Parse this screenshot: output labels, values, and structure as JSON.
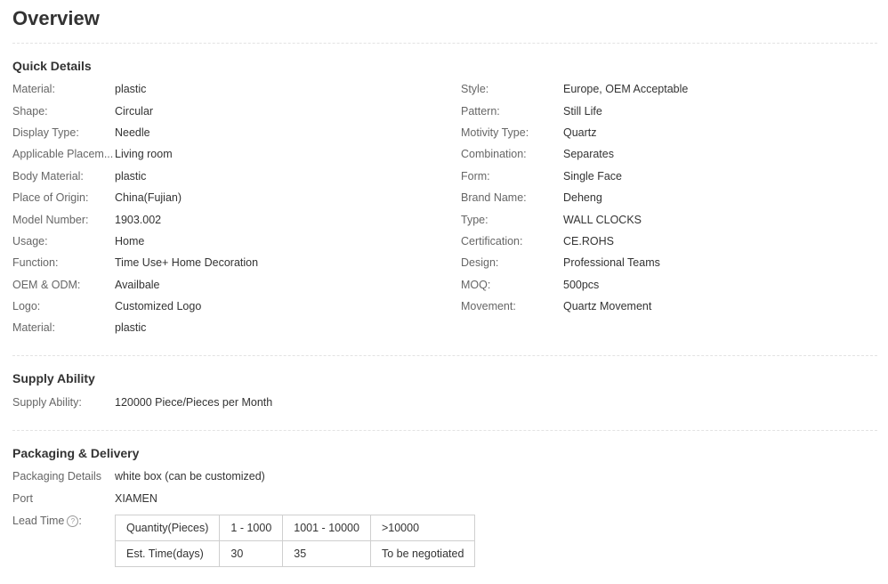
{
  "page_title": "Overview",
  "quick_details": {
    "heading": "Quick Details",
    "left": [
      {
        "label": "Material:",
        "value": "plastic"
      },
      {
        "label": "Shape:",
        "value": "Circular"
      },
      {
        "label": "Display Type:",
        "value": "Needle"
      },
      {
        "label": "Applicable Placem...",
        "value": "Living room"
      },
      {
        "label": "Body Material:",
        "value": "plastic"
      },
      {
        "label": "Place of Origin:",
        "value": "China(Fujian)"
      },
      {
        "label": "Model Number:",
        "value": "1903.002"
      },
      {
        "label": "Usage:",
        "value": "Home"
      },
      {
        "label": "Function:",
        "value": "Time Use+ Home Decoration"
      },
      {
        "label": "OEM & ODM:",
        "value": "Availbale"
      },
      {
        "label": "Logo:",
        "value": "Customized Logo"
      },
      {
        "label": "Material:",
        "value": "plastic"
      }
    ],
    "right": [
      {
        "label": "Style:",
        "value": "Europe, OEM Acceptable"
      },
      {
        "label": "Pattern:",
        "value": "Still Life"
      },
      {
        "label": "Motivity Type:",
        "value": "Quartz"
      },
      {
        "label": "Combination:",
        "value": "Separates"
      },
      {
        "label": "Form:",
        "value": "Single Face"
      },
      {
        "label": "Brand Name:",
        "value": "Deheng"
      },
      {
        "label": "Type:",
        "value": "WALL CLOCKS"
      },
      {
        "label": "Certification:",
        "value": "CE.ROHS"
      },
      {
        "label": "Design:",
        "value": "Professional Teams"
      },
      {
        "label": "MOQ:",
        "value": "500pcs"
      },
      {
        "label": "Movement:",
        "value": "Quartz Movement"
      }
    ]
  },
  "supply_ability": {
    "heading": "Supply Ability",
    "label": "Supply Ability:",
    "value": "120000 Piece/Pieces per Month"
  },
  "packaging": {
    "heading": "Packaging & Delivery",
    "details_label": "Packaging Details",
    "details_value": "white box (can be customized)",
    "port_label": "Port",
    "port_value": "XIAMEN",
    "lead_time_label": "Lead Time",
    "help_icon": "?",
    "lead_time_table": {
      "header": [
        "Quantity(Pieces)",
        "1 - 1000",
        "1001 - 10000",
        ">10000"
      ],
      "row": [
        "Est. Time(days)",
        "30",
        "35",
        "To be negotiated"
      ]
    }
  }
}
